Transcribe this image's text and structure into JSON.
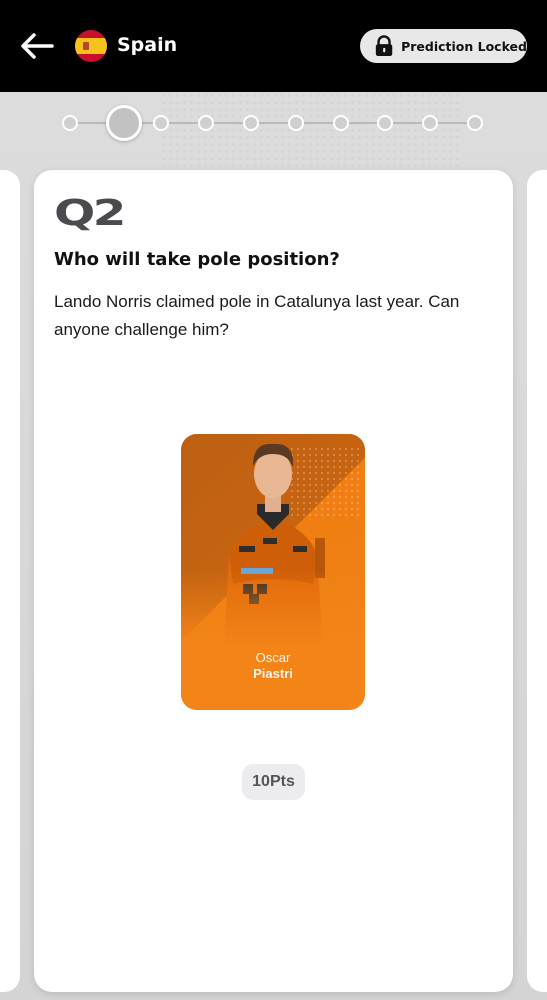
{
  "header": {
    "country": "Spain",
    "status_label": "Prediction Locked",
    "icons": [
      "back-arrow-icon",
      "spain-flag-icon",
      "lock-icon"
    ]
  },
  "stepper": {
    "total_steps": 10,
    "current_step": 2
  },
  "question_card": {
    "number_label": "Q2",
    "question": "Who will take pole position?",
    "description": "Lando Norris claimed pole in Catalunya last year. Can anyone challenge him?",
    "driver": {
      "first_name": "Oscar",
      "last_name": "Piastri",
      "card_color": "#f07a10"
    },
    "points": "10Pts"
  },
  "colors": {
    "header_bg": "#000000",
    "accent_orange": "#f07a10",
    "badge_gray": "#4a4a4f"
  }
}
